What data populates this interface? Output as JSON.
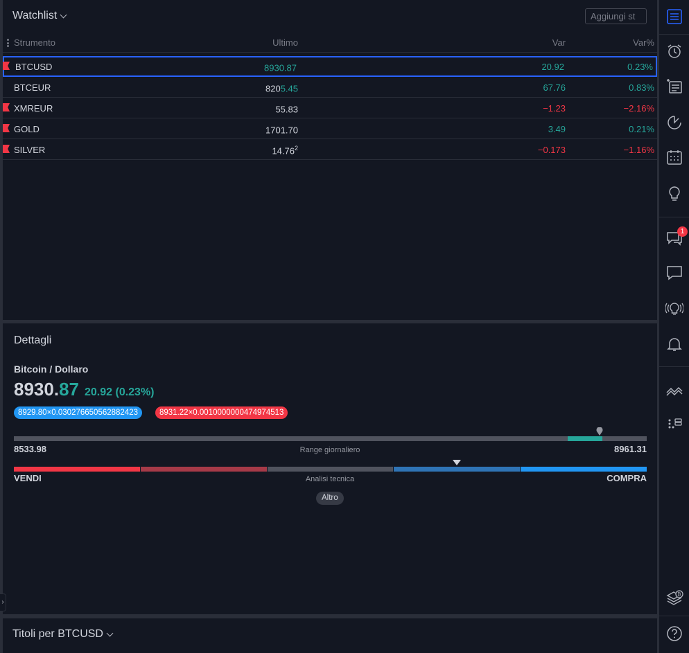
{
  "watchlist": {
    "title": "Watchlist",
    "add_placeholder": "Aggiungi st",
    "columns": {
      "symbol": "Strumento",
      "last": "Ultimo",
      "change": "Var",
      "change_pct": "Var%"
    },
    "rows": [
      {
        "symbol": "BTCUSD",
        "last_main": "8930.87",
        "last_hl": "",
        "last_sup": "",
        "change": "20.92",
        "change_pct": "0.23%",
        "direction": "up",
        "flagged": true,
        "selected": true
      },
      {
        "symbol": "BTCEUR",
        "last_main": "820",
        "last_hl": "5.45",
        "last_sup": "",
        "change": "67.76",
        "change_pct": "0.83%",
        "direction": "up",
        "flagged": false,
        "selected": false
      },
      {
        "symbol": "XMREUR",
        "last_main": "55.83",
        "last_hl": "",
        "last_sup": "",
        "change": "−1.23",
        "change_pct": "−2.16%",
        "direction": "down",
        "flagged": true,
        "selected": false
      },
      {
        "symbol": "GOLD",
        "last_main": "1701.70",
        "last_hl": "",
        "last_sup": "",
        "change": "3.49",
        "change_pct": "0.21%",
        "direction": "up",
        "flagged": true,
        "selected": false
      },
      {
        "symbol": "SILVER",
        "last_main": "14.76",
        "last_hl": "",
        "last_sup": "2",
        "change": "−0.173",
        "change_pct": "−1.16%",
        "direction": "down",
        "flagged": true,
        "selected": false
      }
    ]
  },
  "details": {
    "title": "Dettagli",
    "name": "Bitcoin / Dollaro",
    "price_int": "8930.",
    "price_dec": "87",
    "change": "20.92 (0.23%)",
    "bid": "8929.80×0.030276650562882423",
    "ask": "8931.22×0.0010000000474974513",
    "range": {
      "low": "8533.98",
      "high": "8961.31",
      "label": "Range giornaliero",
      "current_fraction": 0.93
    },
    "technical": {
      "sell": "VENDI",
      "buy": "COMPRA",
      "label": "Analisi tecnica",
      "more": "Altro"
    }
  },
  "bottom": {
    "title": "Titoli per BTCUSD"
  },
  "toolbar": {
    "icons": [
      "watchlist-icon",
      "alarm-clock-icon",
      "news-icon",
      "hotlist-icon",
      "calendar-icon",
      "ideas-icon",
      "chats-icon",
      "private-chat-icon",
      "ideas-stream-icon",
      "notifications-icon",
      "data-window-icon",
      "order-panel-icon",
      "crypto-icon",
      "help-icon"
    ],
    "chat_badge": "1"
  },
  "colors": {
    "up": "#26a69a",
    "down": "#f23645",
    "accent": "#2962ff",
    "panel": "#131722",
    "background": "#2a2e39"
  }
}
